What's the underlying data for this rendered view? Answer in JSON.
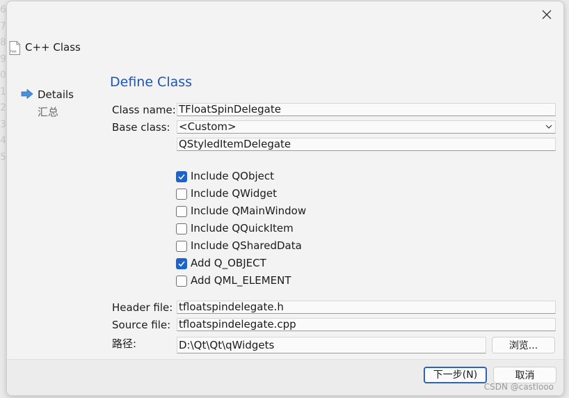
{
  "background": {
    "line_numbers": [
      "6",
      "7",
      "8",
      "9",
      "0",
      "1",
      "2",
      "3",
      "4",
      "5"
    ]
  },
  "dialog": {
    "title": "C++ Class",
    "file_icon_text": "hpp",
    "close_icon": "close-icon"
  },
  "nav": {
    "items": [
      {
        "label": "Details",
        "active": true
      },
      {
        "label": "汇总",
        "active": false
      }
    ]
  },
  "form": {
    "section_title": "Define Class",
    "class_name_label": "Class name:",
    "class_name_value": "TFloatSpinDelegate",
    "base_class_label": "Base class:",
    "base_class_selected": "<Custom>",
    "base_class_custom_value": "QStyledItemDelegate",
    "checkboxes": [
      {
        "label": "Include QObject",
        "checked": true
      },
      {
        "label": "Include QWidget",
        "checked": false
      },
      {
        "label": "Include QMainWindow",
        "checked": false
      },
      {
        "label": "Include QQuickItem",
        "checked": false
      },
      {
        "label": "Include QSharedData",
        "checked": false
      },
      {
        "label": "Add Q_OBJECT",
        "checked": true
      },
      {
        "label": "Add QML_ELEMENT",
        "checked": false
      }
    ],
    "header_file_label": "Header file:",
    "header_file_value": "tfloatspindelegate.h",
    "source_file_label": "Source file:",
    "source_file_value": "tfloatspindelegate.cpp",
    "path_label": "路径:",
    "path_value": "D:\\Qt\\Qt\\qWidgets",
    "browse_label": "浏览..."
  },
  "footer": {
    "next_label": "下一步(N)",
    "cancel_label": "取消"
  },
  "watermark": "CSDN @castlooo",
  "colors": {
    "accent": "#1d54b5",
    "checkbox_checked": "#1d63c9",
    "nav_arrow": "#4a8fdc"
  }
}
